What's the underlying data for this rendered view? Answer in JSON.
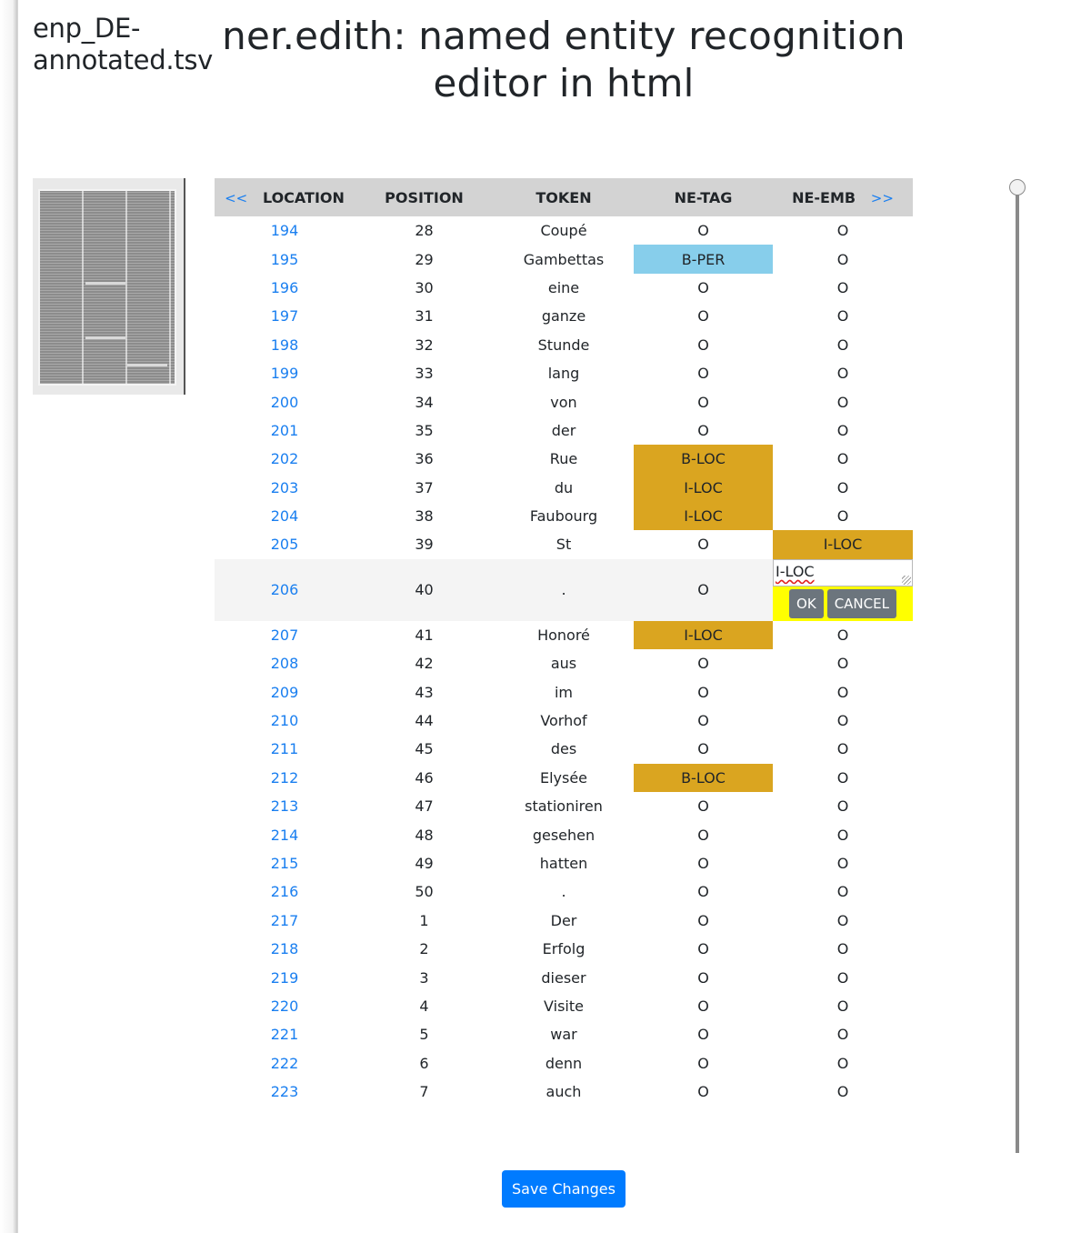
{
  "file": {
    "name": "enp_DE-annotated.tsv"
  },
  "header": {
    "title": "ner.edith: named entity recognition editor in html"
  },
  "thumbnail": {
    "alt": "newspaper page scan"
  },
  "table": {
    "prev_label": "<<",
    "next_label": ">>",
    "columns": [
      "LOCATION",
      "POSITION",
      "TOKEN",
      "NE-TAG",
      "NE-EMB"
    ],
    "rows": [
      {
        "location": "194",
        "position": "28",
        "token": "Coupé",
        "ne_tag": "O",
        "ne_emb": "O"
      },
      {
        "location": "195",
        "position": "29",
        "token": "Gambettas",
        "ne_tag": "B-PER",
        "ne_emb": "O"
      },
      {
        "location": "196",
        "position": "30",
        "token": "eine",
        "ne_tag": "O",
        "ne_emb": "O"
      },
      {
        "location": "197",
        "position": "31",
        "token": "ganze",
        "ne_tag": "O",
        "ne_emb": "O"
      },
      {
        "location": "198",
        "position": "32",
        "token": "Stunde",
        "ne_tag": "O",
        "ne_emb": "O"
      },
      {
        "location": "199",
        "position": "33",
        "token": "lang",
        "ne_tag": "O",
        "ne_emb": "O"
      },
      {
        "location": "200",
        "position": "34",
        "token": "von",
        "ne_tag": "O",
        "ne_emb": "O"
      },
      {
        "location": "201",
        "position": "35",
        "token": "der",
        "ne_tag": "O",
        "ne_emb": "O"
      },
      {
        "location": "202",
        "position": "36",
        "token": "Rue",
        "ne_tag": "B-LOC",
        "ne_emb": "O"
      },
      {
        "location": "203",
        "position": "37",
        "token": "du",
        "ne_tag": "I-LOC",
        "ne_emb": "O"
      },
      {
        "location": "204",
        "position": "38",
        "token": "Faubourg",
        "ne_tag": "I-LOC",
        "ne_emb": "O"
      },
      {
        "location": "205",
        "position": "39",
        "token": "St",
        "ne_tag": "O",
        "ne_emb": "I-LOC"
      },
      {
        "location": "206",
        "position": "40",
        "token": ".",
        "ne_tag": "O",
        "ne_emb": "I-LOC",
        "editing": true
      },
      {
        "location": "207",
        "position": "41",
        "token": "Honoré",
        "ne_tag": "I-LOC",
        "ne_emb": "O"
      },
      {
        "location": "208",
        "position": "42",
        "token": "aus",
        "ne_tag": "O",
        "ne_emb": "O"
      },
      {
        "location": "209",
        "position": "43",
        "token": "im",
        "ne_tag": "O",
        "ne_emb": "O"
      },
      {
        "location": "210",
        "position": "44",
        "token": "Vorhof",
        "ne_tag": "O",
        "ne_emb": "O"
      },
      {
        "location": "211",
        "position": "45",
        "token": "des",
        "ne_tag": "O",
        "ne_emb": "O"
      },
      {
        "location": "212",
        "position": "46",
        "token": "Elysée",
        "ne_tag": "B-LOC",
        "ne_emb": "O"
      },
      {
        "location": "213",
        "position": "47",
        "token": "stationiren",
        "ne_tag": "O",
        "ne_emb": "O"
      },
      {
        "location": "214",
        "position": "48",
        "token": "gesehen",
        "ne_tag": "O",
        "ne_emb": "O"
      },
      {
        "location": "215",
        "position": "49",
        "token": "hatten",
        "ne_tag": "O",
        "ne_emb": "O"
      },
      {
        "location": "216",
        "position": "50",
        "token": ".",
        "ne_tag": "O",
        "ne_emb": "O"
      },
      {
        "location": "217",
        "position": "1",
        "token": "Der",
        "ne_tag": "O",
        "ne_emb": "O"
      },
      {
        "location": "218",
        "position": "2",
        "token": "Erfolg",
        "ne_tag": "O",
        "ne_emb": "O"
      },
      {
        "location": "219",
        "position": "3",
        "token": "dieser",
        "ne_tag": "O",
        "ne_emb": "O"
      },
      {
        "location": "220",
        "position": "4",
        "token": "Visite",
        "ne_tag": "O",
        "ne_emb": "O"
      },
      {
        "location": "221",
        "position": "5",
        "token": "war",
        "ne_tag": "O",
        "ne_emb": "O"
      },
      {
        "location": "222",
        "position": "6",
        "token": "denn",
        "ne_tag": "O",
        "ne_emb": "O"
      },
      {
        "location": "223",
        "position": "7",
        "token": "auch",
        "ne_tag": "O",
        "ne_emb": "O"
      }
    ]
  },
  "editor": {
    "value": "I-LOC",
    "ok_label": "OK",
    "cancel_label": "CANCEL"
  },
  "tag_colors": {
    "PER": "#87ceeb",
    "LOC": "#daa520",
    "edit_bg": "#ffff00"
  },
  "scroll": {
    "position_fraction": 0.0
  },
  "footer": {
    "save_label": "Save Changes"
  }
}
